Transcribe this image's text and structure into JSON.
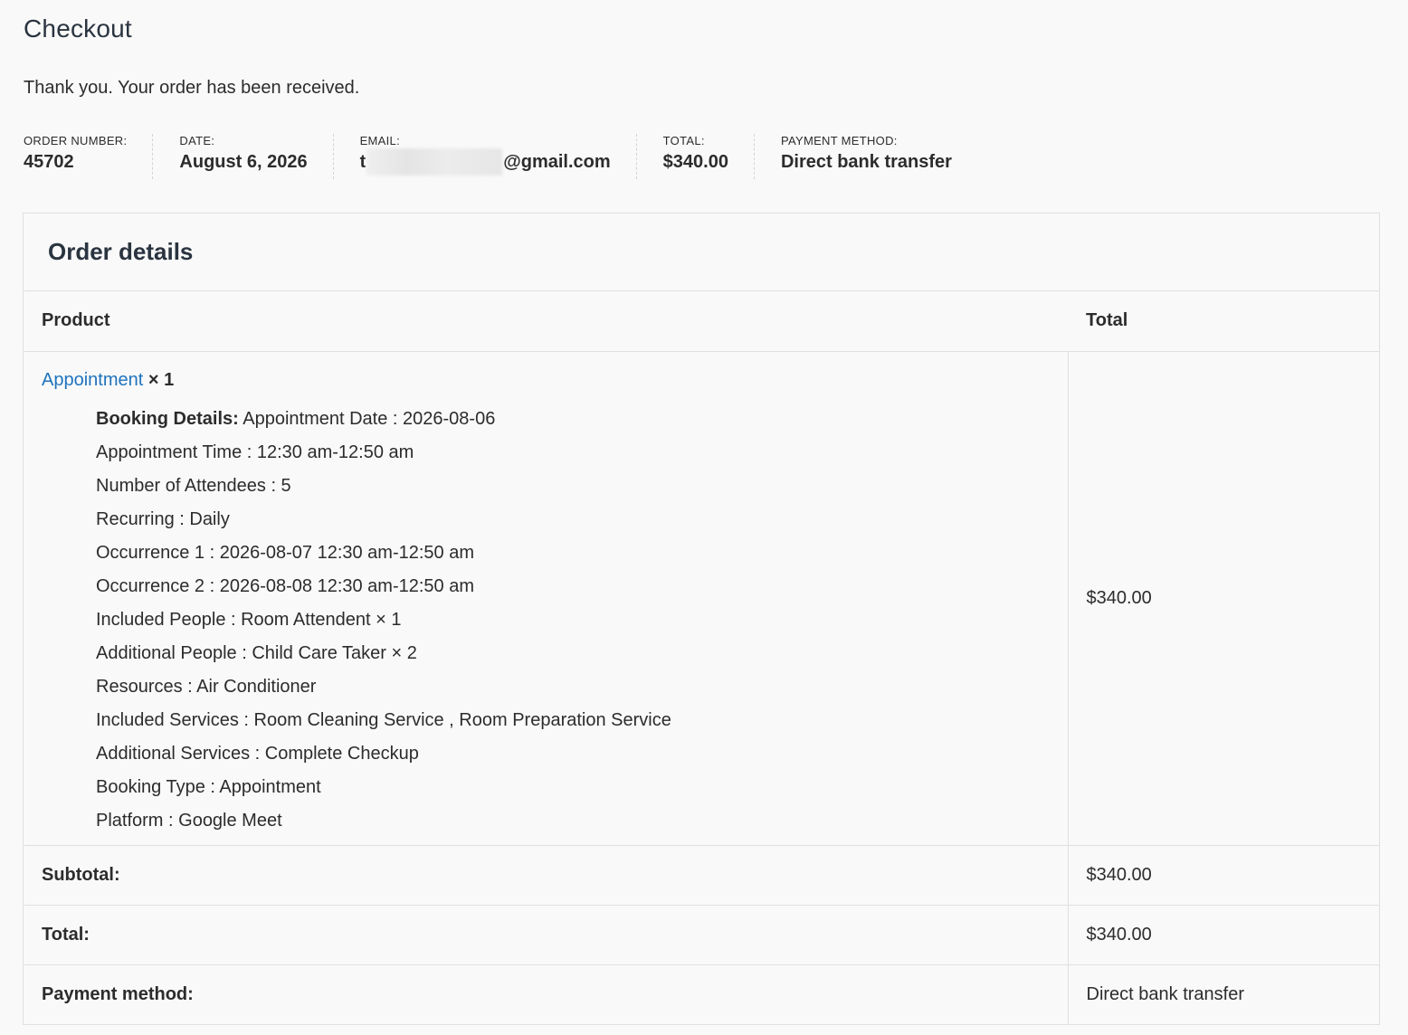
{
  "page": {
    "title": "Checkout",
    "thank_you": "Thank you. Your order has been received."
  },
  "overview": {
    "order_number_label": "ORDER NUMBER:",
    "order_number": "45702",
    "date_label": "DATE:",
    "date": "August 6, 2026",
    "email_label": "EMAIL:",
    "email_prefix": "t",
    "email_suffix": "@gmail.com",
    "total_label": "TOTAL:",
    "total": "$340.00",
    "payment_label": "PAYMENT METHOD:",
    "payment": "Direct bank transfer"
  },
  "order_details": {
    "title": "Order details",
    "col_product": "Product",
    "col_total": "Total",
    "item": {
      "name": "Appointment",
      "qty": "× 1",
      "total": "$340.00",
      "booking_details_label": "Booking Details:",
      "meta": [
        "Appointment Date : 2026-08-06",
        "Appointment Time : 12:30 am-12:50 am",
        "Number of Attendees : 5",
        "Recurring : Daily",
        "Occurrence 1 : 2026-08-07 12:30 am-12:50 am",
        "Occurrence 2 : 2026-08-08 12:30 am-12:50 am",
        "Included People : Room Attendent × 1",
        "Additional People : Child Care Taker × 2",
        "Resources : Air Conditioner",
        "Included Services : Room Cleaning Service , Room Preparation Service",
        "Additional Services : Complete Checkup",
        "Booking Type : Appointment",
        "Platform : Google Meet"
      ]
    },
    "subtotal_label": "Subtotal:",
    "subtotal": "$340.00",
    "total_label": "Total:",
    "total": "$340.00",
    "payment_label": "Payment method:",
    "payment": "Direct bank transfer"
  },
  "colors": {
    "link": "#1e73be",
    "background": "#f9f9f9",
    "border": "#e0e0e0"
  }
}
